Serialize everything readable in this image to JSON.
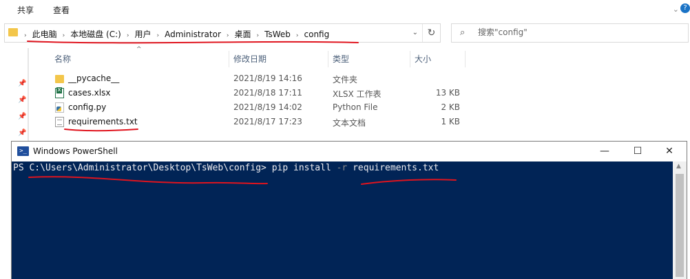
{
  "ribbon": {
    "tabs": [
      "共享",
      "查看"
    ],
    "chevron": "⌄",
    "help": "?"
  },
  "address": {
    "crumbs": [
      "此电脑",
      "本地磁盘 (C:)",
      "用户",
      "Administrator",
      "桌面",
      "TsWeb",
      "config"
    ],
    "separator": "›",
    "dropdown": "⌄",
    "refresh": "↻"
  },
  "search": {
    "placeholder": "搜索\"config\"",
    "icon": "⌕"
  },
  "columns": {
    "name": "名称",
    "date": "修改日期",
    "type": "类型",
    "size": "大小"
  },
  "files": [
    {
      "name": "__pycache__",
      "date": "2021/8/19 14:16",
      "type": "文件夹",
      "size": "",
      "icon": "folder-icon"
    },
    {
      "name": "cases.xlsx",
      "date": "2021/8/18 17:11",
      "type": "XLSX 工作表",
      "size": "13 KB",
      "icon": "xlsx-file-icon"
    },
    {
      "name": "config.py",
      "date": "2021/8/19 14:02",
      "type": "Python File",
      "size": "2 KB",
      "icon": "python-file-icon"
    },
    {
      "name": "requirements.txt",
      "date": "2021/8/17 17:23",
      "type": "文本文档",
      "size": "1 KB",
      "icon": "text-file-icon"
    }
  ],
  "powershell": {
    "title": "Windows PowerShell",
    "minimize": "—",
    "maximize": "☐",
    "close": "✕",
    "prompt": "PS C:\\Users\\Administrator\\Desktop\\TsWeb\\config> ",
    "command": "pip install ",
    "flag": "-r",
    "argument": " requirements.txt"
  },
  "colors": {
    "console_bg": "#012456",
    "annotation": "#e0141e",
    "header_text": "#4b5f79"
  }
}
